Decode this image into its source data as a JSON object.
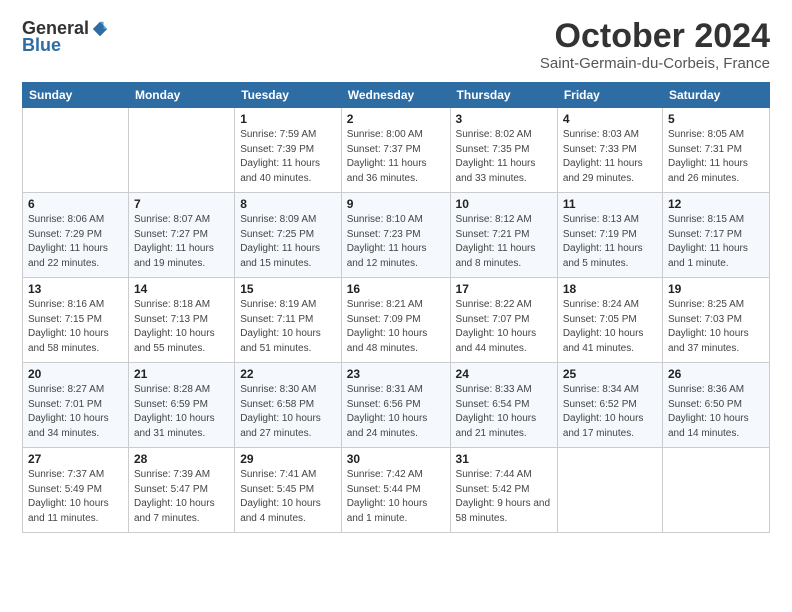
{
  "logo": {
    "general": "General",
    "blue": "Blue"
  },
  "title": "October 2024",
  "location": "Saint-Germain-du-Corbeis, France",
  "days_header": [
    "Sunday",
    "Monday",
    "Tuesday",
    "Wednesday",
    "Thursday",
    "Friday",
    "Saturday"
  ],
  "weeks": [
    [
      {
        "day": "",
        "info": ""
      },
      {
        "day": "",
        "info": ""
      },
      {
        "day": "1",
        "info": "Sunrise: 7:59 AM\nSunset: 7:39 PM\nDaylight: 11 hours and 40 minutes."
      },
      {
        "day": "2",
        "info": "Sunrise: 8:00 AM\nSunset: 7:37 PM\nDaylight: 11 hours and 36 minutes."
      },
      {
        "day": "3",
        "info": "Sunrise: 8:02 AM\nSunset: 7:35 PM\nDaylight: 11 hours and 33 minutes."
      },
      {
        "day": "4",
        "info": "Sunrise: 8:03 AM\nSunset: 7:33 PM\nDaylight: 11 hours and 29 minutes."
      },
      {
        "day": "5",
        "info": "Sunrise: 8:05 AM\nSunset: 7:31 PM\nDaylight: 11 hours and 26 minutes."
      }
    ],
    [
      {
        "day": "6",
        "info": "Sunrise: 8:06 AM\nSunset: 7:29 PM\nDaylight: 11 hours and 22 minutes."
      },
      {
        "day": "7",
        "info": "Sunrise: 8:07 AM\nSunset: 7:27 PM\nDaylight: 11 hours and 19 minutes."
      },
      {
        "day": "8",
        "info": "Sunrise: 8:09 AM\nSunset: 7:25 PM\nDaylight: 11 hours and 15 minutes."
      },
      {
        "day": "9",
        "info": "Sunrise: 8:10 AM\nSunset: 7:23 PM\nDaylight: 11 hours and 12 minutes."
      },
      {
        "day": "10",
        "info": "Sunrise: 8:12 AM\nSunset: 7:21 PM\nDaylight: 11 hours and 8 minutes."
      },
      {
        "day": "11",
        "info": "Sunrise: 8:13 AM\nSunset: 7:19 PM\nDaylight: 11 hours and 5 minutes."
      },
      {
        "day": "12",
        "info": "Sunrise: 8:15 AM\nSunset: 7:17 PM\nDaylight: 11 hours and 1 minute."
      }
    ],
    [
      {
        "day": "13",
        "info": "Sunrise: 8:16 AM\nSunset: 7:15 PM\nDaylight: 10 hours and 58 minutes."
      },
      {
        "day": "14",
        "info": "Sunrise: 8:18 AM\nSunset: 7:13 PM\nDaylight: 10 hours and 55 minutes."
      },
      {
        "day": "15",
        "info": "Sunrise: 8:19 AM\nSunset: 7:11 PM\nDaylight: 10 hours and 51 minutes."
      },
      {
        "day": "16",
        "info": "Sunrise: 8:21 AM\nSunset: 7:09 PM\nDaylight: 10 hours and 48 minutes."
      },
      {
        "day": "17",
        "info": "Sunrise: 8:22 AM\nSunset: 7:07 PM\nDaylight: 10 hours and 44 minutes."
      },
      {
        "day": "18",
        "info": "Sunrise: 8:24 AM\nSunset: 7:05 PM\nDaylight: 10 hours and 41 minutes."
      },
      {
        "day": "19",
        "info": "Sunrise: 8:25 AM\nSunset: 7:03 PM\nDaylight: 10 hours and 37 minutes."
      }
    ],
    [
      {
        "day": "20",
        "info": "Sunrise: 8:27 AM\nSunset: 7:01 PM\nDaylight: 10 hours and 34 minutes."
      },
      {
        "day": "21",
        "info": "Sunrise: 8:28 AM\nSunset: 6:59 PM\nDaylight: 10 hours and 31 minutes."
      },
      {
        "day": "22",
        "info": "Sunrise: 8:30 AM\nSunset: 6:58 PM\nDaylight: 10 hours and 27 minutes."
      },
      {
        "day": "23",
        "info": "Sunrise: 8:31 AM\nSunset: 6:56 PM\nDaylight: 10 hours and 24 minutes."
      },
      {
        "day": "24",
        "info": "Sunrise: 8:33 AM\nSunset: 6:54 PM\nDaylight: 10 hours and 21 minutes."
      },
      {
        "day": "25",
        "info": "Sunrise: 8:34 AM\nSunset: 6:52 PM\nDaylight: 10 hours and 17 minutes."
      },
      {
        "day": "26",
        "info": "Sunrise: 8:36 AM\nSunset: 6:50 PM\nDaylight: 10 hours and 14 minutes."
      }
    ],
    [
      {
        "day": "27",
        "info": "Sunrise: 7:37 AM\nSunset: 5:49 PM\nDaylight: 10 hours and 11 minutes."
      },
      {
        "day": "28",
        "info": "Sunrise: 7:39 AM\nSunset: 5:47 PM\nDaylight: 10 hours and 7 minutes."
      },
      {
        "day": "29",
        "info": "Sunrise: 7:41 AM\nSunset: 5:45 PM\nDaylight: 10 hours and 4 minutes."
      },
      {
        "day": "30",
        "info": "Sunrise: 7:42 AM\nSunset: 5:44 PM\nDaylight: 10 hours and 1 minute."
      },
      {
        "day": "31",
        "info": "Sunrise: 7:44 AM\nSunset: 5:42 PM\nDaylight: 9 hours and 58 minutes."
      },
      {
        "day": "",
        "info": ""
      },
      {
        "day": "",
        "info": ""
      }
    ]
  ]
}
